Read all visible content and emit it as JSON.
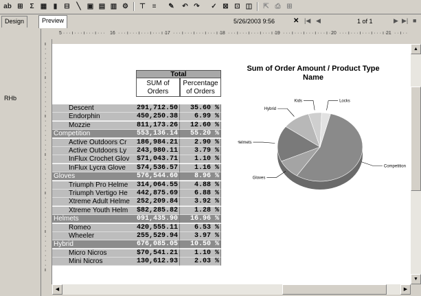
{
  "toolbar": {
    "icons": [
      "ab-text-icon",
      "grid-icon",
      "sigma-icon",
      "field-list-icon",
      "chart-icon",
      "group-icon",
      "line-icon",
      "image-icon",
      "subreport-icon",
      "database-icon",
      "gear-icon",
      "align-left-icon",
      "align-center-icon",
      "format-painter-icon",
      "undo-icon",
      "redo-icon",
      "spell-icon",
      "field-icon",
      "hyperlink-icon",
      "preview-icon",
      "export-icon",
      "print-icon",
      "zoom-icon"
    ],
    "ab_label": "ab"
  },
  "tabs": {
    "design": "Design",
    "preview": "Preview"
  },
  "nav": {
    "datetime": "5/26/2003  9:56",
    "page": "1 of 1"
  },
  "gutter": {
    "section_label": "RHb"
  },
  "ruler": {
    "marks": [
      "16",
      "17",
      "18",
      "19",
      "20",
      "21"
    ]
  },
  "table": {
    "header_total": "Total",
    "col1": "SUM of Orders",
    "col2": "Percentage of Orders",
    "rows": [
      {
        "label": "Descent",
        "sum": "291,712.50",
        "pct": "35.60 %",
        "group": false
      },
      {
        "label": "Endorphin",
        "sum": "450,250.38",
        "pct": "6.99 %",
        "group": false
      },
      {
        "label": "Mozzie",
        "sum": "811,173.26",
        "pct": "12.60 %",
        "group": false
      },
      {
        "label": "Competition",
        "sum": "553,136.14",
        "pct": "55.20 %",
        "group": true
      },
      {
        "label": "Active Outdoors Cr",
        "sum": "186,984.21",
        "pct": "2.90 %",
        "group": false
      },
      {
        "label": "Active Outdoors Ly",
        "sum": "243,980.11",
        "pct": "3.79 %",
        "group": false
      },
      {
        "label": "InFlux Crochet Glov",
        "sum": "$71,043.71",
        "pct": "1.10 %",
        "group": false
      },
      {
        "label": "InFlux Lycra Glove",
        "sum": "$74,536.57",
        "pct": "1.16 %",
        "group": false
      },
      {
        "label": "Gloves",
        "sum": "576,544.60",
        "pct": "8.96 %",
        "group": true
      },
      {
        "label": "Triumph Pro Helme",
        "sum": "314,064.55",
        "pct": "4.88 %",
        "group": false
      },
      {
        "label": "Triumph Vertigo He",
        "sum": "442,875.69",
        "pct": "6.88 %",
        "group": false
      },
      {
        "label": "Xtreme Adult Helme",
        "sum": "252,209.84",
        "pct": "3.92 %",
        "group": false
      },
      {
        "label": "Xtreme Youth Helm",
        "sum": "$82,285.82",
        "pct": "1.28 %",
        "group": false
      },
      {
        "label": "Helmets",
        "sum": "091,435.90",
        "pct": "16.96 %",
        "group": true
      },
      {
        "label": "Romeo",
        "sum": "420,555.11",
        "pct": "6.53 %",
        "group": false
      },
      {
        "label": "Wheeler",
        "sum": "255,529.94",
        "pct": "3.97 %",
        "group": false
      },
      {
        "label": "Hybrid",
        "sum": "676,085.05",
        "pct": "10.50 %",
        "group": true
      },
      {
        "label": "Micro Nicros",
        "sum": "$70,541.21",
        "pct": "1.10 %",
        "group": false
      },
      {
        "label": "Mini Nicros",
        "sum": "130,612.93",
        "pct": "2.03 %",
        "group": false
      }
    ]
  },
  "chart_data": {
    "type": "pie",
    "title": "Sum of Order Amount / Product Type Name",
    "categories": [
      "Competition",
      "Gloves",
      "Helmets",
      "Hybrid",
      "Kids",
      "Locks"
    ],
    "values": [
      55.2,
      8.96,
      16.96,
      10.5,
      5.0,
      3.4
    ],
    "colors": [
      "#8a8a8a",
      "#a4a4a4",
      "#7a7a7a",
      "#b8b8b8",
      "#cfcfcf",
      "#e2e2e2"
    ],
    "labels_display": [
      "Competition",
      "Gloves",
      "Helmets",
      "Hybrid",
      "Kids",
      "Locks"
    ]
  }
}
